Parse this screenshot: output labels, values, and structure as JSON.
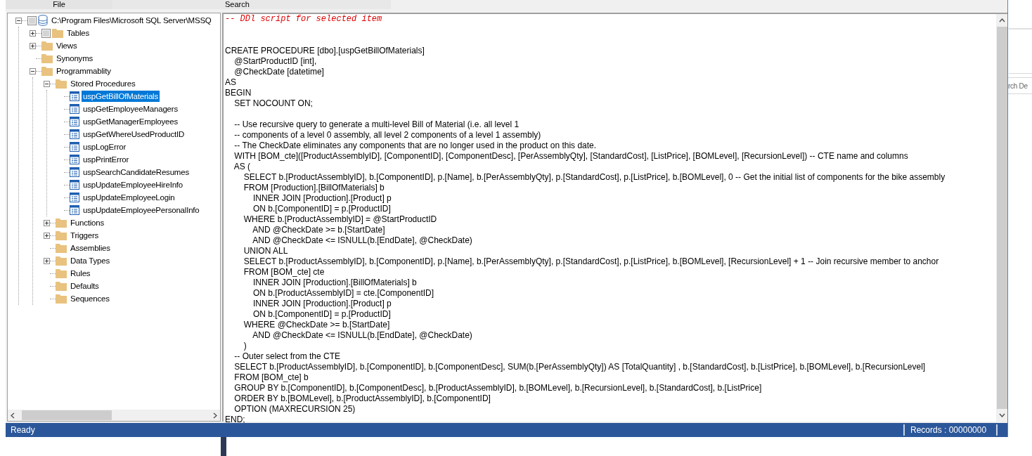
{
  "header_tabs": [
    {
      "label": "File"
    },
    {
      "label": "Search"
    }
  ],
  "tree": [
    {
      "label": "C:\\Program Files\\Microsoft SQL Server\\MSSQ",
      "kind": "database",
      "expander": true,
      "expanded": true,
      "checkbox": true,
      "selected": false,
      "children": [
        {
          "label": "Tables",
          "kind": "folder",
          "expander": true,
          "expanded": false,
          "checkbox": true,
          "selected": false
        },
        {
          "label": "Views",
          "kind": "folder",
          "expander": true,
          "expanded": false,
          "checkbox": false,
          "selected": false
        },
        {
          "label": "Synonyms",
          "kind": "folder",
          "expander": false,
          "checkbox": false,
          "selected": false
        },
        {
          "label": "Programmablity",
          "kind": "folder",
          "expander": true,
          "expanded": true,
          "checkbox": false,
          "selected": false,
          "children": [
            {
              "label": "Stored Procedures",
              "kind": "folder",
              "expander": true,
              "expanded": true,
              "checkbox": false,
              "selected": false,
              "children": [
                {
                  "label": "uspGetBillOfMaterials",
                  "kind": "procedure",
                  "expander": false,
                  "checkbox": false,
                  "selected": true
                },
                {
                  "label": "uspGetEmployeeManagers",
                  "kind": "procedure",
                  "expander": false,
                  "checkbox": false,
                  "selected": false
                },
                {
                  "label": "uspGetManagerEmployees",
                  "kind": "procedure",
                  "expander": false,
                  "checkbox": false,
                  "selected": false
                },
                {
                  "label": "uspGetWhereUsedProductID",
                  "kind": "procedure",
                  "expander": false,
                  "checkbox": false,
                  "selected": false
                },
                {
                  "label": "uspLogError",
                  "kind": "procedure",
                  "expander": false,
                  "checkbox": false,
                  "selected": false
                },
                {
                  "label": "uspPrintError",
                  "kind": "procedure",
                  "expander": false,
                  "checkbox": false,
                  "selected": false
                },
                {
                  "label": "uspSearchCandidateResumes",
                  "kind": "procedure",
                  "expander": false,
                  "checkbox": false,
                  "selected": false
                },
                {
                  "label": "uspUpdateEmployeeHireInfo",
                  "kind": "procedure",
                  "expander": false,
                  "checkbox": false,
                  "selected": false
                },
                {
                  "label": "uspUpdateEmployeeLogin",
                  "kind": "procedure",
                  "expander": false,
                  "checkbox": false,
                  "selected": false
                },
                {
                  "label": "uspUpdateEmployeePersonalInfo",
                  "kind": "procedure",
                  "expander": false,
                  "checkbox": false,
                  "selected": false
                }
              ]
            },
            {
              "label": "Functions",
              "kind": "folder",
              "expander": true,
              "expanded": false,
              "checkbox": false,
              "selected": false
            },
            {
              "label": "Triggers",
              "kind": "folder",
              "expander": true,
              "expanded": false,
              "checkbox": false,
              "selected": false
            },
            {
              "label": "Assemblies",
              "kind": "folder",
              "expander": false,
              "checkbox": false,
              "selected": false
            },
            {
              "label": "Data Types",
              "kind": "folder",
              "expander": true,
              "expanded": false,
              "checkbox": false,
              "selected": false
            },
            {
              "label": "Rules",
              "kind": "folder",
              "expander": false,
              "checkbox": false,
              "selected": false
            },
            {
              "label": "Defaults",
              "kind": "folder",
              "expander": false,
              "checkbox": false,
              "selected": false
            },
            {
              "label": "Sequences",
              "kind": "folder",
              "expander": false,
              "checkbox": false,
              "selected": false
            }
          ]
        }
      ]
    }
  ],
  "editor": {
    "lines": [
      {
        "kind": "comment",
        "text": "-- DDl script for selected item"
      },
      {
        "kind": "blank"
      },
      {
        "kind": "blank"
      },
      {
        "kind": "code",
        "text": "CREATE PROCEDURE [dbo].[uspGetBillOfMaterials]"
      },
      {
        "kind": "code",
        "text": "    @StartProductID [int],"
      },
      {
        "kind": "code",
        "text": "    @CheckDate [datetime]"
      },
      {
        "kind": "code",
        "text": "AS"
      },
      {
        "kind": "code",
        "text": "BEGIN"
      },
      {
        "kind": "code",
        "text": "    SET NOCOUNT ON;"
      },
      {
        "kind": "blank"
      },
      {
        "kind": "code",
        "text": "    -- Use recursive query to generate a multi-level Bill of Material (i.e. all level 1"
      },
      {
        "kind": "code",
        "text": "    -- components of a level 0 assembly, all level 2 components of a level 1 assembly)"
      },
      {
        "kind": "code",
        "text": "    -- The CheckDate eliminates any components that are no longer used in the product on this date."
      },
      {
        "kind": "code",
        "text": "    WITH [BOM_cte]([ProductAssemblyID], [ComponentID], [ComponentDesc], [PerAssemblyQty], [StandardCost], [ListPrice], [BOMLevel], [RecursionLevel]) -- CTE name and columns"
      },
      {
        "kind": "code",
        "text": "    AS ("
      },
      {
        "kind": "code",
        "text": "        SELECT b.[ProductAssemblyID], b.[ComponentID], p.[Name], b.[PerAssemblyQty], p.[StandardCost], p.[ListPrice], b.[BOMLevel], 0 -- Get the initial list of components for the bike assembly"
      },
      {
        "kind": "code",
        "text": "        FROM [Production].[BillOfMaterials] b"
      },
      {
        "kind": "code",
        "text": "            INNER JOIN [Production].[Product] p"
      },
      {
        "kind": "code",
        "text": "            ON b.[ComponentID] = p.[ProductID]"
      },
      {
        "kind": "code",
        "text": "        WHERE b.[ProductAssemblyID] = @StartProductID"
      },
      {
        "kind": "code",
        "text": "            AND @CheckDate >= b.[StartDate]"
      },
      {
        "kind": "code",
        "text": "            AND @CheckDate <= ISNULL(b.[EndDate], @CheckDate)"
      },
      {
        "kind": "code",
        "text": "        UNION ALL"
      },
      {
        "kind": "code",
        "text": "        SELECT b.[ProductAssemblyID], b.[ComponentID], p.[Name], b.[PerAssemblyQty], p.[StandardCost], p.[ListPrice], b.[BOMLevel], [RecursionLevel] + 1 -- Join recursive member to anchor"
      },
      {
        "kind": "code",
        "text": "        FROM [BOM_cte] cte"
      },
      {
        "kind": "code",
        "text": "            INNER JOIN [Production].[BillOfMaterials] b"
      },
      {
        "kind": "code",
        "text": "            ON b.[ProductAssemblyID] = cte.[ComponentID]"
      },
      {
        "kind": "code",
        "text": "            INNER JOIN [Production].[Product] p"
      },
      {
        "kind": "code",
        "text": "            ON b.[ComponentID] = p.[ProductID]"
      },
      {
        "kind": "code",
        "text": "        WHERE @CheckDate >= b.[StartDate]"
      },
      {
        "kind": "code",
        "text": "            AND @CheckDate <= ISNULL(b.[EndDate], @CheckDate)"
      },
      {
        "kind": "code",
        "text": "        )"
      },
      {
        "kind": "code",
        "text": "    -- Outer select from the CTE"
      },
      {
        "kind": "code",
        "text": "    SELECT b.[ProductAssemblyID], b.[ComponentID], b.[ComponentDesc], SUM(b.[PerAssemblyQty]) AS [TotalQuantity] , b.[StandardCost], b.[ListPrice], b.[BOMLevel], b.[RecursionLevel]"
      },
      {
        "kind": "code",
        "text": "    FROM [BOM_cte] b"
      },
      {
        "kind": "code",
        "text": "    GROUP BY b.[ComponentID], b.[ComponentDesc], b.[ProductAssemblyID], b.[BOMLevel], b.[RecursionLevel], b.[StandardCost], b.[ListPrice]"
      },
      {
        "kind": "code",
        "text": "    ORDER BY b.[BOMLevel], b.[ProductAssemblyID], b.[ComponentID]"
      },
      {
        "kind": "code",
        "text": "    OPTION (MAXRECURSION 25)"
      },
      {
        "kind": "code",
        "text": "END;"
      }
    ]
  },
  "status_bar": {
    "left": "Ready",
    "right": "Records : 00000000"
  },
  "background": {
    "partial_text": "rch De"
  }
}
